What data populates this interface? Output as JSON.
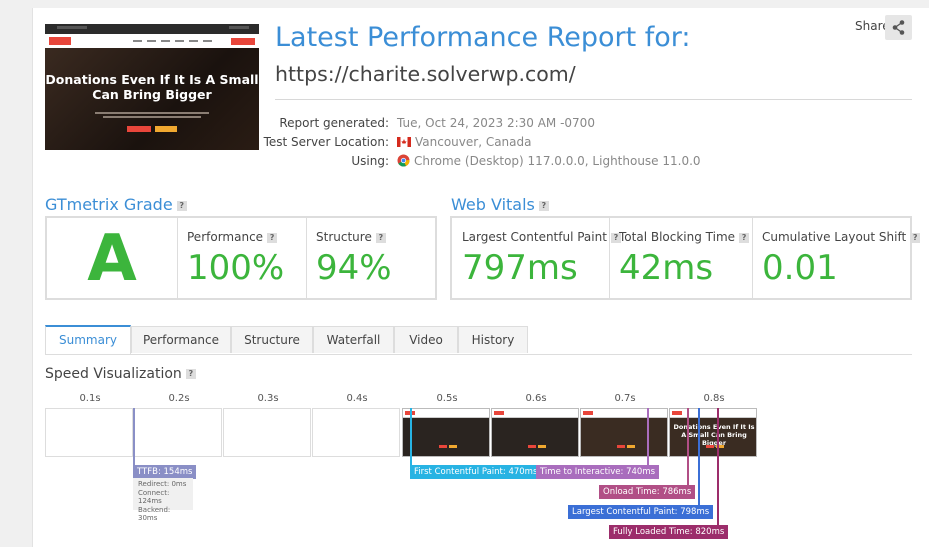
{
  "thumbnail": {
    "headline": "Donations Even If It Is A Small Can Bring Bigger",
    "logo": "CHARITE"
  },
  "header": {
    "title": "Latest Performance Report for:",
    "url": "https://charite.solverwp.com/"
  },
  "share_label": "Share",
  "meta": {
    "generated_label": "Report generated:",
    "generated_value": "Tue, Oct 24, 2023 2:30 AM -0700",
    "location_label": "Test Server Location:",
    "location_value": "Vancouver, Canada",
    "using_label": "Using:",
    "using_value": "Chrome (Desktop) 117.0.0.0, Lighthouse 11.0.0"
  },
  "grade": {
    "title": "GTmetrix Grade",
    "letter": "A",
    "performance_label": "Performance",
    "performance_value": "100%",
    "structure_label": "Structure",
    "structure_value": "94%"
  },
  "vitals": {
    "title": "Web Vitals",
    "lcp_label": "Largest Contentful Paint",
    "lcp_value": "797ms",
    "tbt_label": "Total Blocking Time",
    "tbt_value": "42ms",
    "cls_label": "Cumulative Layout Shift",
    "cls_value": "0.01"
  },
  "tabs": [
    "Summary",
    "Performance",
    "Structure",
    "Waterfall",
    "Video",
    "History"
  ],
  "speed": {
    "title": "Speed Visualization",
    "ticks": [
      "0.1s",
      "0.2s",
      "0.3s",
      "0.4s",
      "0.5s",
      "0.6s",
      "0.7s",
      "0.8s"
    ],
    "frame_headline": "Donations Even If It Is A Small Can Bring Bigger",
    "ttfb": "TTFB: 154ms",
    "ttfb_detail": [
      "Redirect: 0ms",
      "Connect: 124ms",
      "Backend: 30ms"
    ],
    "fcp": "First Contentful Paint: 470ms",
    "tti": "Time to Interactive: 740ms",
    "onload": "Onload Time: 786ms",
    "lcp": "Largest Contentful Paint: 798ms",
    "fully": "Fully Loaded Time: 820ms"
  },
  "colors": {
    "accent": "#3b8ed6",
    "good": "#3cb53c",
    "ttfb": "#8a8fc6",
    "fcp": "#27b3e3",
    "tti": "#a96dbd",
    "onload": "#b14f86",
    "lcp": "#3b6fd6",
    "fully": "#9c2d6b"
  }
}
